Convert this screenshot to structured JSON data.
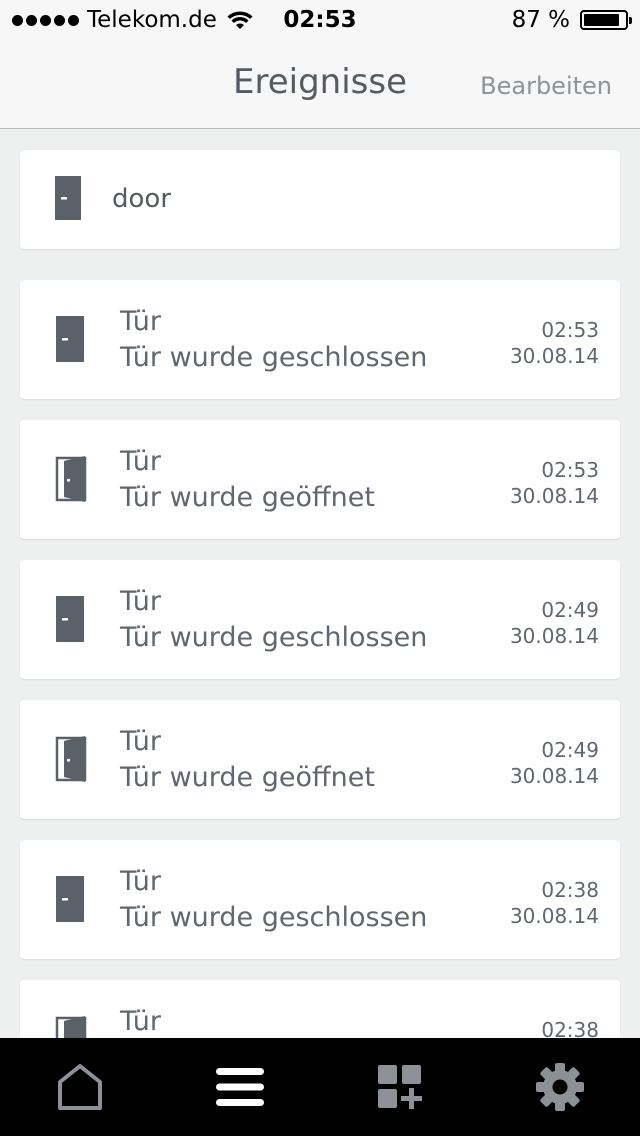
{
  "status_bar": {
    "carrier": "Telekom.de",
    "time": "02:53",
    "battery": "87 %",
    "battery_level": 0.87
  },
  "nav": {
    "title": "Ereignisse",
    "edit_label": "Bearbeiten"
  },
  "device": {
    "name": "door",
    "icon": "door-closed-icon"
  },
  "events": [
    {
      "title": "Tür",
      "text": "Tür wurde geschlossen",
      "time": "02:53",
      "date": "30.08.14",
      "icon": "door-closed-icon"
    },
    {
      "title": "Tür",
      "text": "Tür wurde geöffnet",
      "time": "02:53",
      "date": "30.08.14",
      "icon": "door-open-icon"
    },
    {
      "title": "Tür",
      "text": "Tür wurde geschlossen",
      "time": "02:49",
      "date": "30.08.14",
      "icon": "door-closed-icon"
    },
    {
      "title": "Tür",
      "text": "Tür wurde geöffnet",
      "time": "02:49",
      "date": "30.08.14",
      "icon": "door-open-icon"
    },
    {
      "title": "Tür",
      "text": "Tür wurde geschlossen",
      "time": "02:38",
      "date": "30.08.14",
      "icon": "door-closed-icon"
    },
    {
      "title": "Tür",
      "text": "",
      "time": "02:38",
      "date": "",
      "icon": "door-open-icon"
    }
  ],
  "tabbar": {
    "tabs": [
      {
        "name": "home",
        "icon": "home-icon",
        "active": false
      },
      {
        "name": "events",
        "icon": "menu-icon",
        "active": true
      },
      {
        "name": "add-widget",
        "icon": "grid-add-icon",
        "active": false
      },
      {
        "name": "settings",
        "icon": "gear-icon",
        "active": false
      }
    ],
    "colors": {
      "inactive": "#8b9196",
      "active": "#ffffff",
      "background": "#000000"
    }
  },
  "colors": {
    "text": "#555b61",
    "icon": "#5a6168",
    "background": "#eeefef",
    "card": "#ffffff"
  }
}
